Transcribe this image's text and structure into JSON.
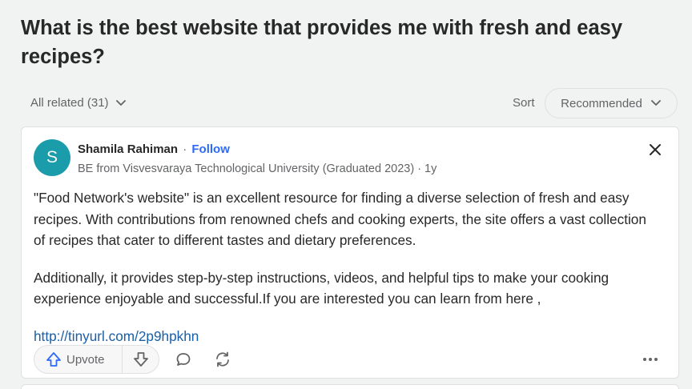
{
  "question": {
    "title": "What is the best website that provides me with fresh and easy recipes?"
  },
  "filter": {
    "all_related": "All related (31)",
    "sort_label": "Sort",
    "sort_value": "Recommended"
  },
  "answer": {
    "avatar_letter": "S",
    "author": "Shamila Rahiman",
    "separator": "·",
    "follow": "Follow",
    "credential": "BE from Visvesvaraya Technological University (Graduated 2023) · 1y",
    "paragraph_1": "\"Food Network's website\" is an excellent resource for finding a diverse selection of fresh and easy recipes. With contributions from renowned chefs and cooking experts, the site offers a vast collection of recipes that cater to different tastes and dietary preferences.",
    "paragraph_2": "Additionally, it provides step-by-step instructions, videos, and helpful tips to make your cooking experience enjoyable and successful.If you are interested you can learn from here ,",
    "link": "http://tinyurl.com/2p9hpkhn"
  },
  "actions": {
    "upvote_label": "Upvote"
  },
  "icons": {
    "chevron": "chevron-down-icon",
    "close": "close-icon",
    "upvote": "upvote-arrow-icon",
    "downvote": "downvote-arrow-icon",
    "comment": "comment-icon",
    "share": "share-icon",
    "more": "more-icon"
  },
  "colors": {
    "background": "#f1f2f2",
    "avatar": "#1a9caa",
    "follow": "#2e69ff",
    "link": "#195faa",
    "muted_text": "#636466"
  }
}
